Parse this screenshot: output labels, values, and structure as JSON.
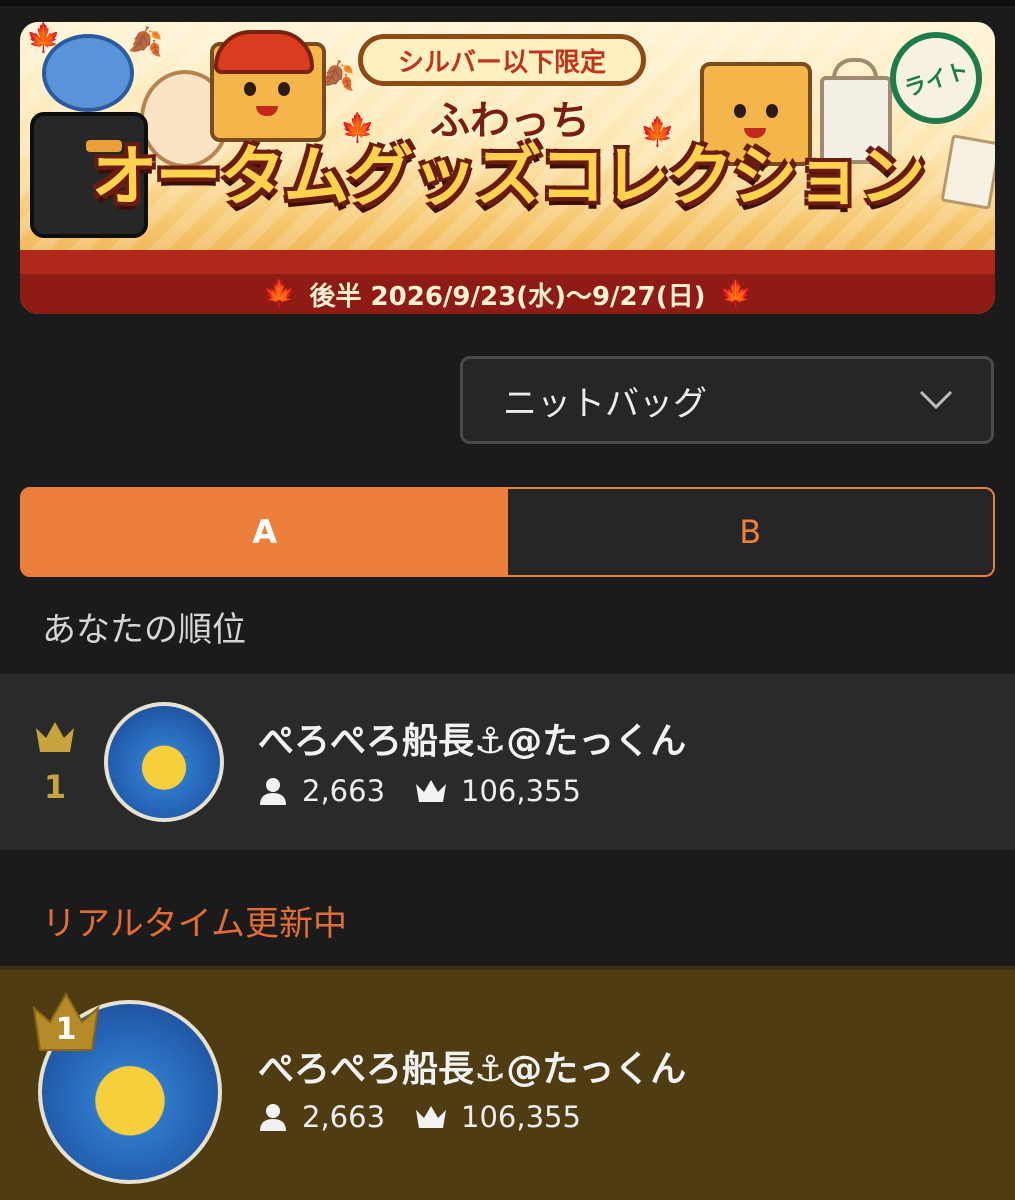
{
  "banner": {
    "pill": "シルバー以下限定",
    "subtitle": "ふわっち",
    "title": "オータムグッズコレクション",
    "badge": "ライト",
    "dates": "後半 2026/9/23(水)〜9/27(日)"
  },
  "selector": {
    "value": "ニットバッグ"
  },
  "tabs": [
    {
      "label": "A",
      "active": true
    },
    {
      "label": "B",
      "active": false
    }
  ],
  "my_rank": {
    "section_label": "あなたの順位",
    "rank": "1",
    "name": "ぺろぺろ船長⚓@たっくん",
    "followers": "2,663",
    "points": "106,355"
  },
  "realtime": {
    "label": "リアルタイム更新中",
    "entries": [
      {
        "rank": "1",
        "name": "ぺろぺろ船長⚓@たっくん",
        "followers": "2,663",
        "points": "106,355"
      }
    ]
  },
  "colors": {
    "accent": "#ec7f3c",
    "gold": "#c7a43e",
    "top1_bg": "#4f3c12",
    "page_bg": "#1b1b1b"
  },
  "icons": {
    "rank": "crown-icon",
    "followers": "person-icon",
    "points": "crown-icon",
    "dropdown": "chevron-down-icon"
  }
}
